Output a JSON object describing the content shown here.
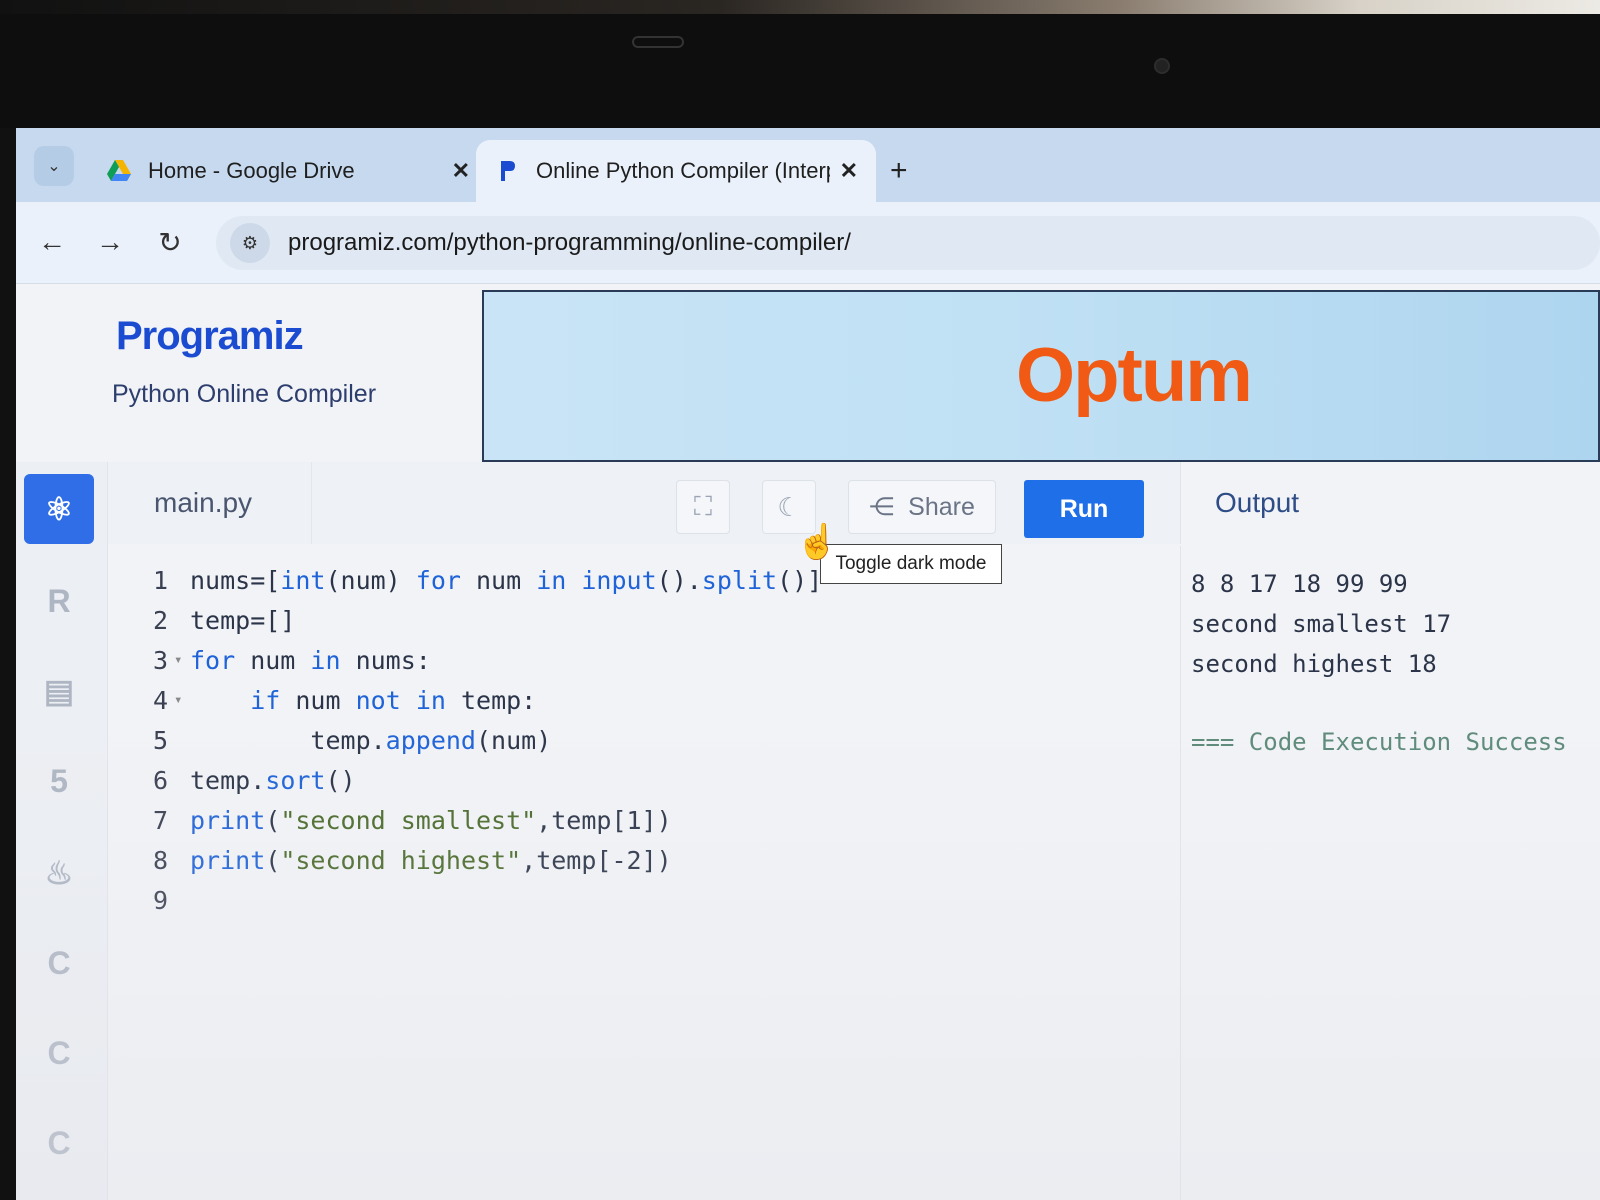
{
  "browser": {
    "tabs": [
      {
        "title": "Home - Google Drive",
        "active": false
      },
      {
        "title": "Online Python Compiler (Interp",
        "active": true
      }
    ],
    "tab_close": "✕",
    "new_tab": "+",
    "tab_menu_icon": "⌄",
    "url": "programiz.com/python-programming/online-compiler/",
    "nav": {
      "back": "←",
      "forward": "→",
      "reload": "↻",
      "site_info": "⚙"
    }
  },
  "page": {
    "logo": "Programiz",
    "subtitle": "Python Online Compiler",
    "ad_brand": "Optum"
  },
  "sidebar": {
    "languages": [
      {
        "icon": "python-icon",
        "glyph": "⚛",
        "active": true
      },
      {
        "icon": "r-icon",
        "glyph": "R",
        "active": false
      },
      {
        "icon": "sql-icon",
        "glyph": "▤",
        "active": false
      },
      {
        "icon": "html-icon",
        "glyph": "5",
        "active": false
      },
      {
        "icon": "java-icon",
        "glyph": "♨",
        "active": false
      },
      {
        "icon": "c-icon",
        "glyph": "C",
        "active": false
      },
      {
        "icon": "cpp-icon",
        "glyph": "C",
        "active": false
      },
      {
        "icon": "csharp-icon",
        "glyph": "C",
        "active": false
      }
    ]
  },
  "editor": {
    "filename": "main.py",
    "fullscreen_icon": "⛶",
    "dark_mode_icon": "☾",
    "share_icon": "⋲",
    "share_label": "Share",
    "run_label": "Run",
    "tooltip": "Toggle dark mode",
    "lines": [
      {
        "n": "1",
        "fold": "",
        "code": "nums=[int(num) for num in input().split()]"
      },
      {
        "n": "2",
        "fold": "",
        "code": "temp=[]"
      },
      {
        "n": "3",
        "fold": "▾",
        "code": "for num in nums:"
      },
      {
        "n": "4",
        "fold": "▾",
        "code": "    if num not in temp:"
      },
      {
        "n": "5",
        "fold": "",
        "code": "        temp.append(num)"
      },
      {
        "n": "6",
        "fold": "",
        "code": "temp.sort()"
      },
      {
        "n": "7",
        "fold": "",
        "code": "print(\"second smallest\",temp[1])"
      },
      {
        "n": "8",
        "fold": "",
        "code": "print(\"second highest\",temp[-2])"
      },
      {
        "n": "9",
        "fold": "",
        "code": ""
      }
    ]
  },
  "output": {
    "title": "Output",
    "lines": [
      "8 8 17 18 99 99",
      "second smallest 17",
      "second highest 18"
    ],
    "status": "=== Code Execution Success"
  },
  "colors": {
    "accent": "#1f6fe8",
    "ad_brand": "#f05a14",
    "keyword": "#1f63d8",
    "string": "#4a6a2a"
  }
}
